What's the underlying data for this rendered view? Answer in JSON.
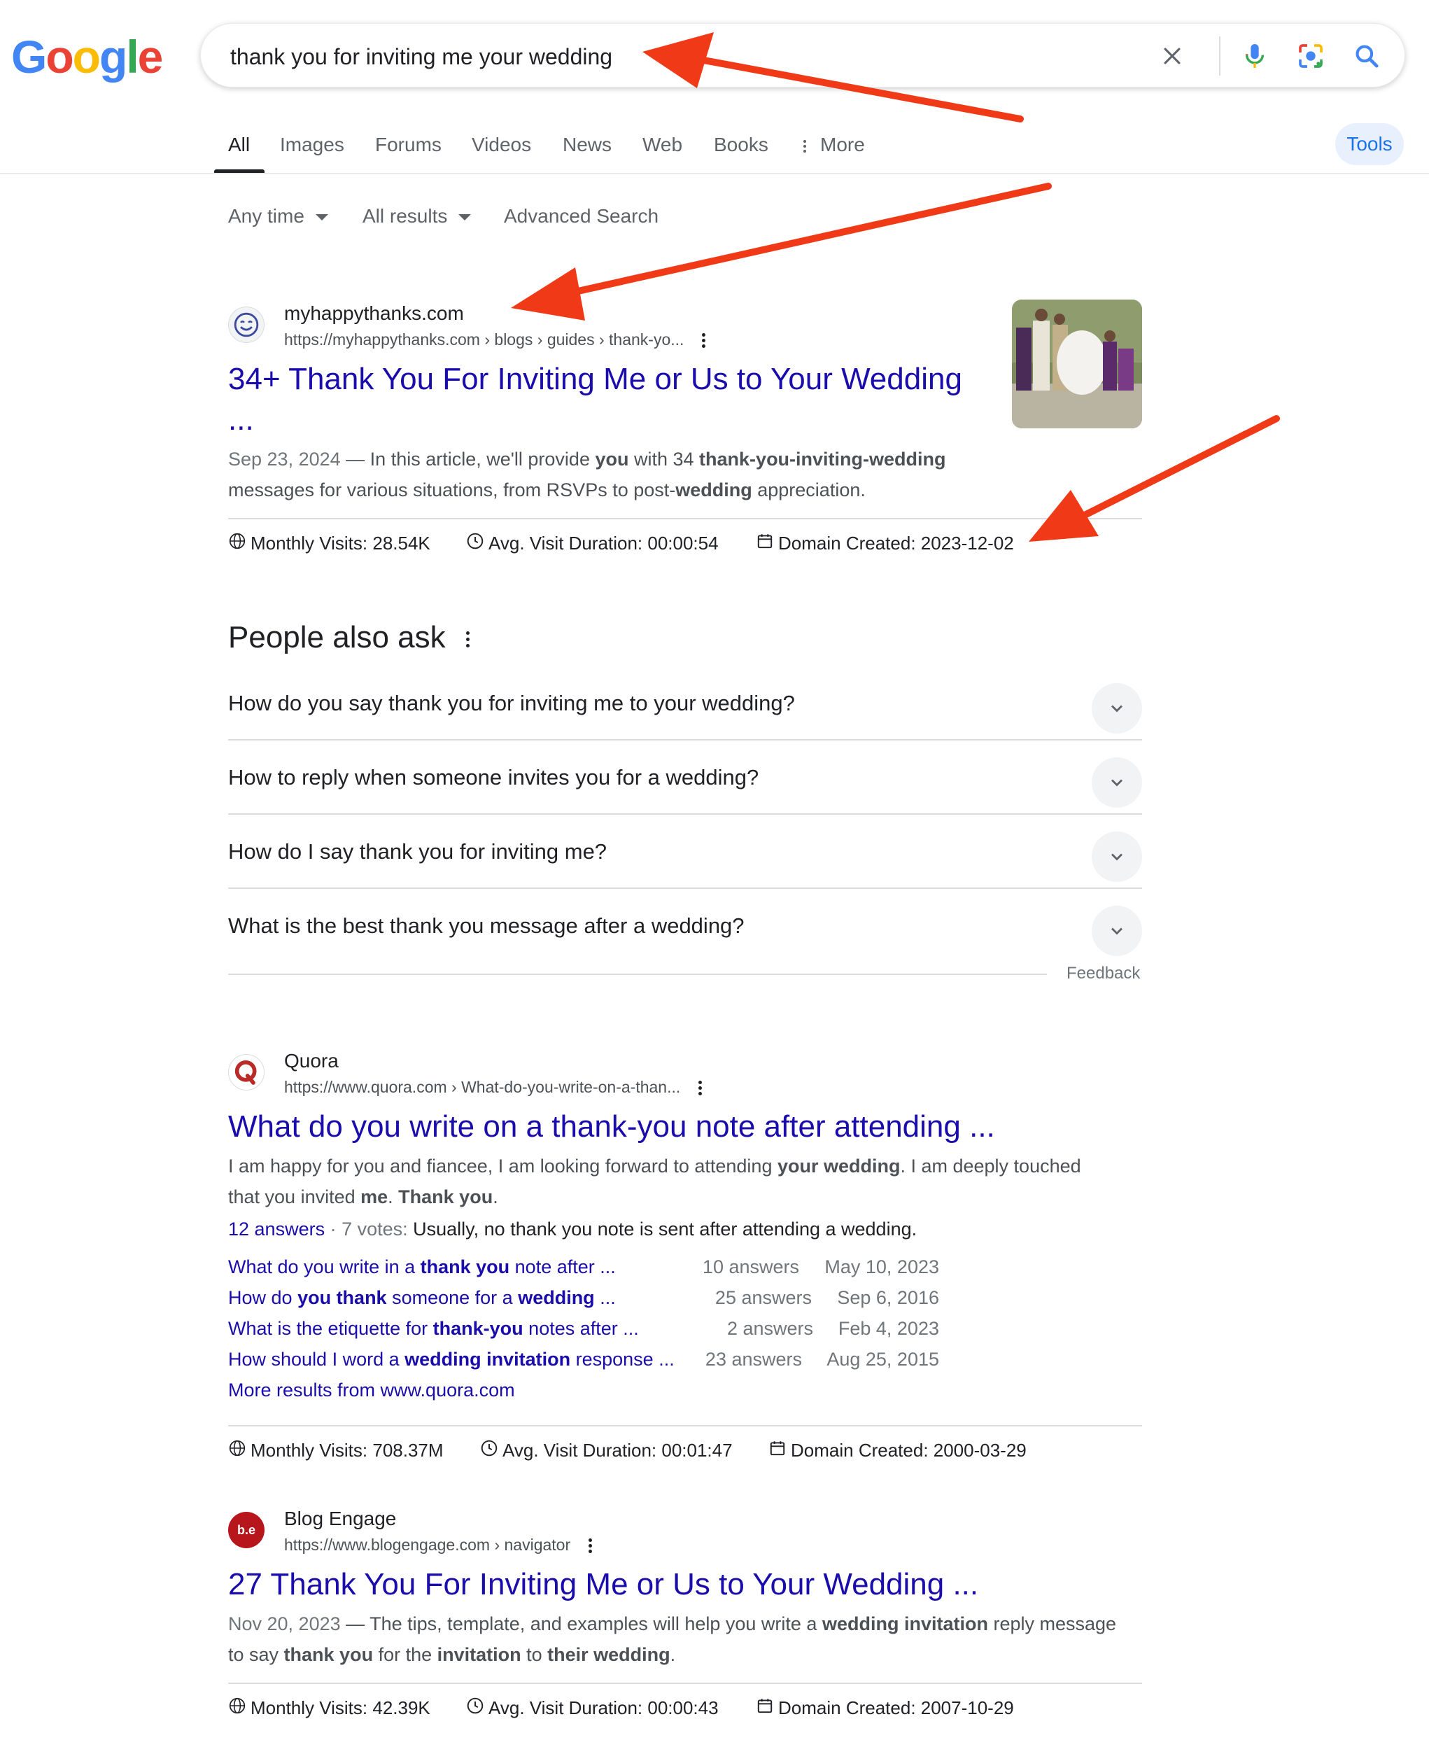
{
  "logo": {
    "text": "Google"
  },
  "search": {
    "query": "thank you for inviting me your wedding"
  },
  "tabs": [
    {
      "label": "All"
    },
    {
      "label": "Images"
    },
    {
      "label": "Forums"
    },
    {
      "label": "Videos"
    },
    {
      "label": "News"
    },
    {
      "label": "Web"
    },
    {
      "label": "Books"
    },
    {
      "label": "More"
    }
  ],
  "tools_label": "Tools",
  "filters": {
    "time": "Any time",
    "results": "All results",
    "advanced": "Advanced Search"
  },
  "results": [
    {
      "site": "myhappythanks.com",
      "url": "https://myhappythanks.com › blogs › guides › thank-yo...",
      "title_line1": "34+ Thank You For Inviting Me or Us to Your Wedding",
      "title_line2": "...",
      "date": "Sep 23, 2024",
      "snippet_parts": [
        "In this article, we'll provide ",
        "you",
        " with 34 ",
        "thank-you-inviting-wedding",
        "messages for various situations, from RSVPs to post-",
        "wedding",
        " appreciation."
      ],
      "meta": {
        "visits": "Monthly Visits: 28.54K",
        "duration": "Avg. Visit Duration: 00:00:54",
        "created": "Domain Created: 2023-12-02"
      }
    },
    {
      "site": "Quora",
      "url": "https://www.quora.com › What-do-you-write-on-a-than...",
      "title_line1": "What do you write on a thank-you note after attending ...",
      "snippet_line1": [
        "I am happy for you and fiancee, I am looking forward to attending ",
        "your wedding",
        ". I am deeply touched"
      ],
      "snippet_line2": [
        "that you invited ",
        "me",
        ". ",
        "Thank you",
        "."
      ],
      "answers_link": "12 answers",
      "votes": " · 7 votes: ",
      "votes_text": "Usually, no thank you note is sent after attending a wedding.",
      "sitelinks": [
        {
          "parts": [
            "What do you write in a ",
            "thank you",
            " note after ..."
          ],
          "answers": "10 answers",
          "date": "May 10, 2023"
        },
        {
          "parts": [
            "How do ",
            "you thank",
            " someone for a ",
            "wedding",
            " ..."
          ],
          "answers": "25 answers",
          "date": "Sep 6, 2016"
        },
        {
          "parts": [
            "What is the etiquette for ",
            "thank-you",
            " notes after ..."
          ],
          "answers": "2 answers",
          "date": "Feb 4, 2023"
        },
        {
          "parts": [
            "How should I word a ",
            "wedding invitation",
            " response ..."
          ],
          "answers": "23 answers",
          "date": "Aug 25, 2015"
        }
      ],
      "more_results": "More results from www.quora.com",
      "meta": {
        "visits": "Monthly Visits: 708.37M",
        "duration": "Avg. Visit Duration: 00:01:47",
        "created": "Domain Created: 2000-03-29"
      }
    },
    {
      "site": "Blog Engage",
      "url": "https://www.blogengage.com › navigator",
      "favicon_text": "b.e",
      "title_line1": "27 Thank You For Inviting Me or Us to Your Wedding ...",
      "date": "Nov 20, 2023",
      "snippet_line1": [
        "The tips, template, and examples will help you write a ",
        "wedding invitation",
        " reply message"
      ],
      "snippet_line2": [
        "to say ",
        "thank you",
        " for the ",
        "invitation",
        " to ",
        "their wedding",
        "."
      ],
      "meta": {
        "visits": "Monthly Visits: 42.39K",
        "duration": "Avg. Visit Duration: 00:00:43",
        "created": "Domain Created: 2007-10-29"
      }
    }
  ],
  "paa": {
    "title": "People also ask",
    "questions": [
      "How do you say thank you for inviting me to your wedding?",
      "How to reply when someone invites you for a wedding?",
      "How do I say thank you for inviting me?",
      "What is the best thank you message after a wedding?"
    ],
    "feedback": "Feedback"
  },
  "colors": {
    "link": "#1a0dab",
    "accent": "#1a73e8",
    "annotation_arrow": "#f03a17"
  }
}
